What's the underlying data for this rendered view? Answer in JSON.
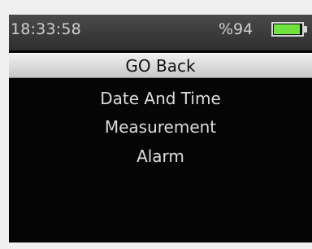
{
  "status_bar": {
    "time": "18:33:58",
    "battery_label": "%94",
    "battery_level": 0.94,
    "battery_color": "#6fe33b"
  },
  "menu": {
    "items": [
      {
        "label": "GO Back",
        "selected": true
      },
      {
        "label": "Date And Time",
        "selected": false
      },
      {
        "label": "Measurement",
        "selected": false
      },
      {
        "label": "Alarm",
        "selected": false
      }
    ]
  }
}
